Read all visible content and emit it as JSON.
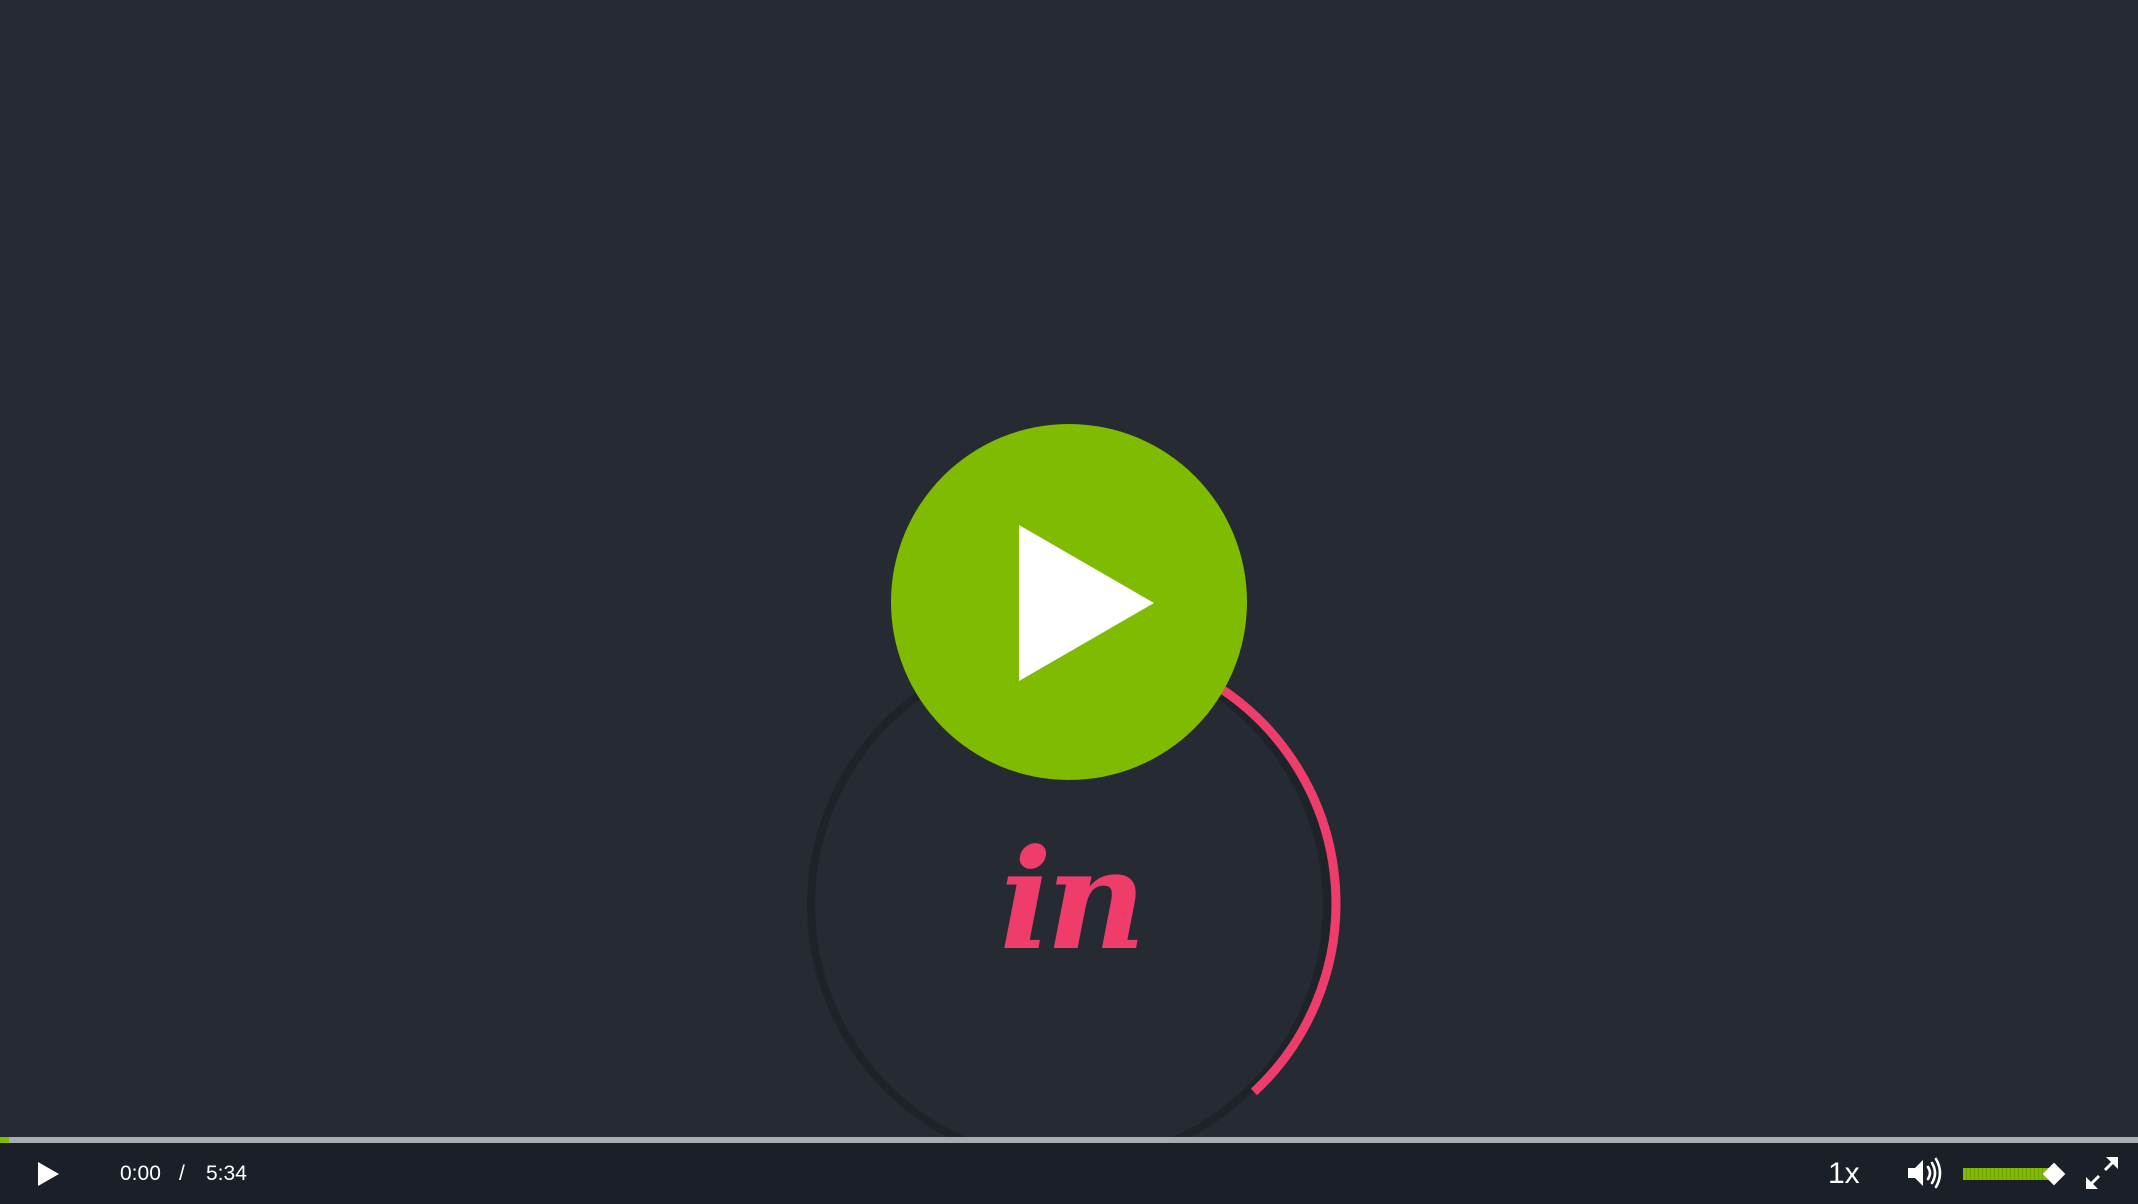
{
  "player": {
    "logo_text": "in",
    "colors": {
      "background": "#262b33",
      "control_bar": "#1b2028",
      "accent_green": "#7fbb00",
      "logo_pink": "#ee3d6b"
    },
    "big_play_icon": "play-icon",
    "progress": 0.004
  },
  "controls": {
    "play_icon": "play-icon",
    "current_time": "0:00",
    "separator": "/",
    "total_time": "5:34",
    "speed": "1x",
    "volume_icon": "volume-icon",
    "volume_level": 0.93,
    "fullscreen_icon": "fullscreen-icon"
  }
}
